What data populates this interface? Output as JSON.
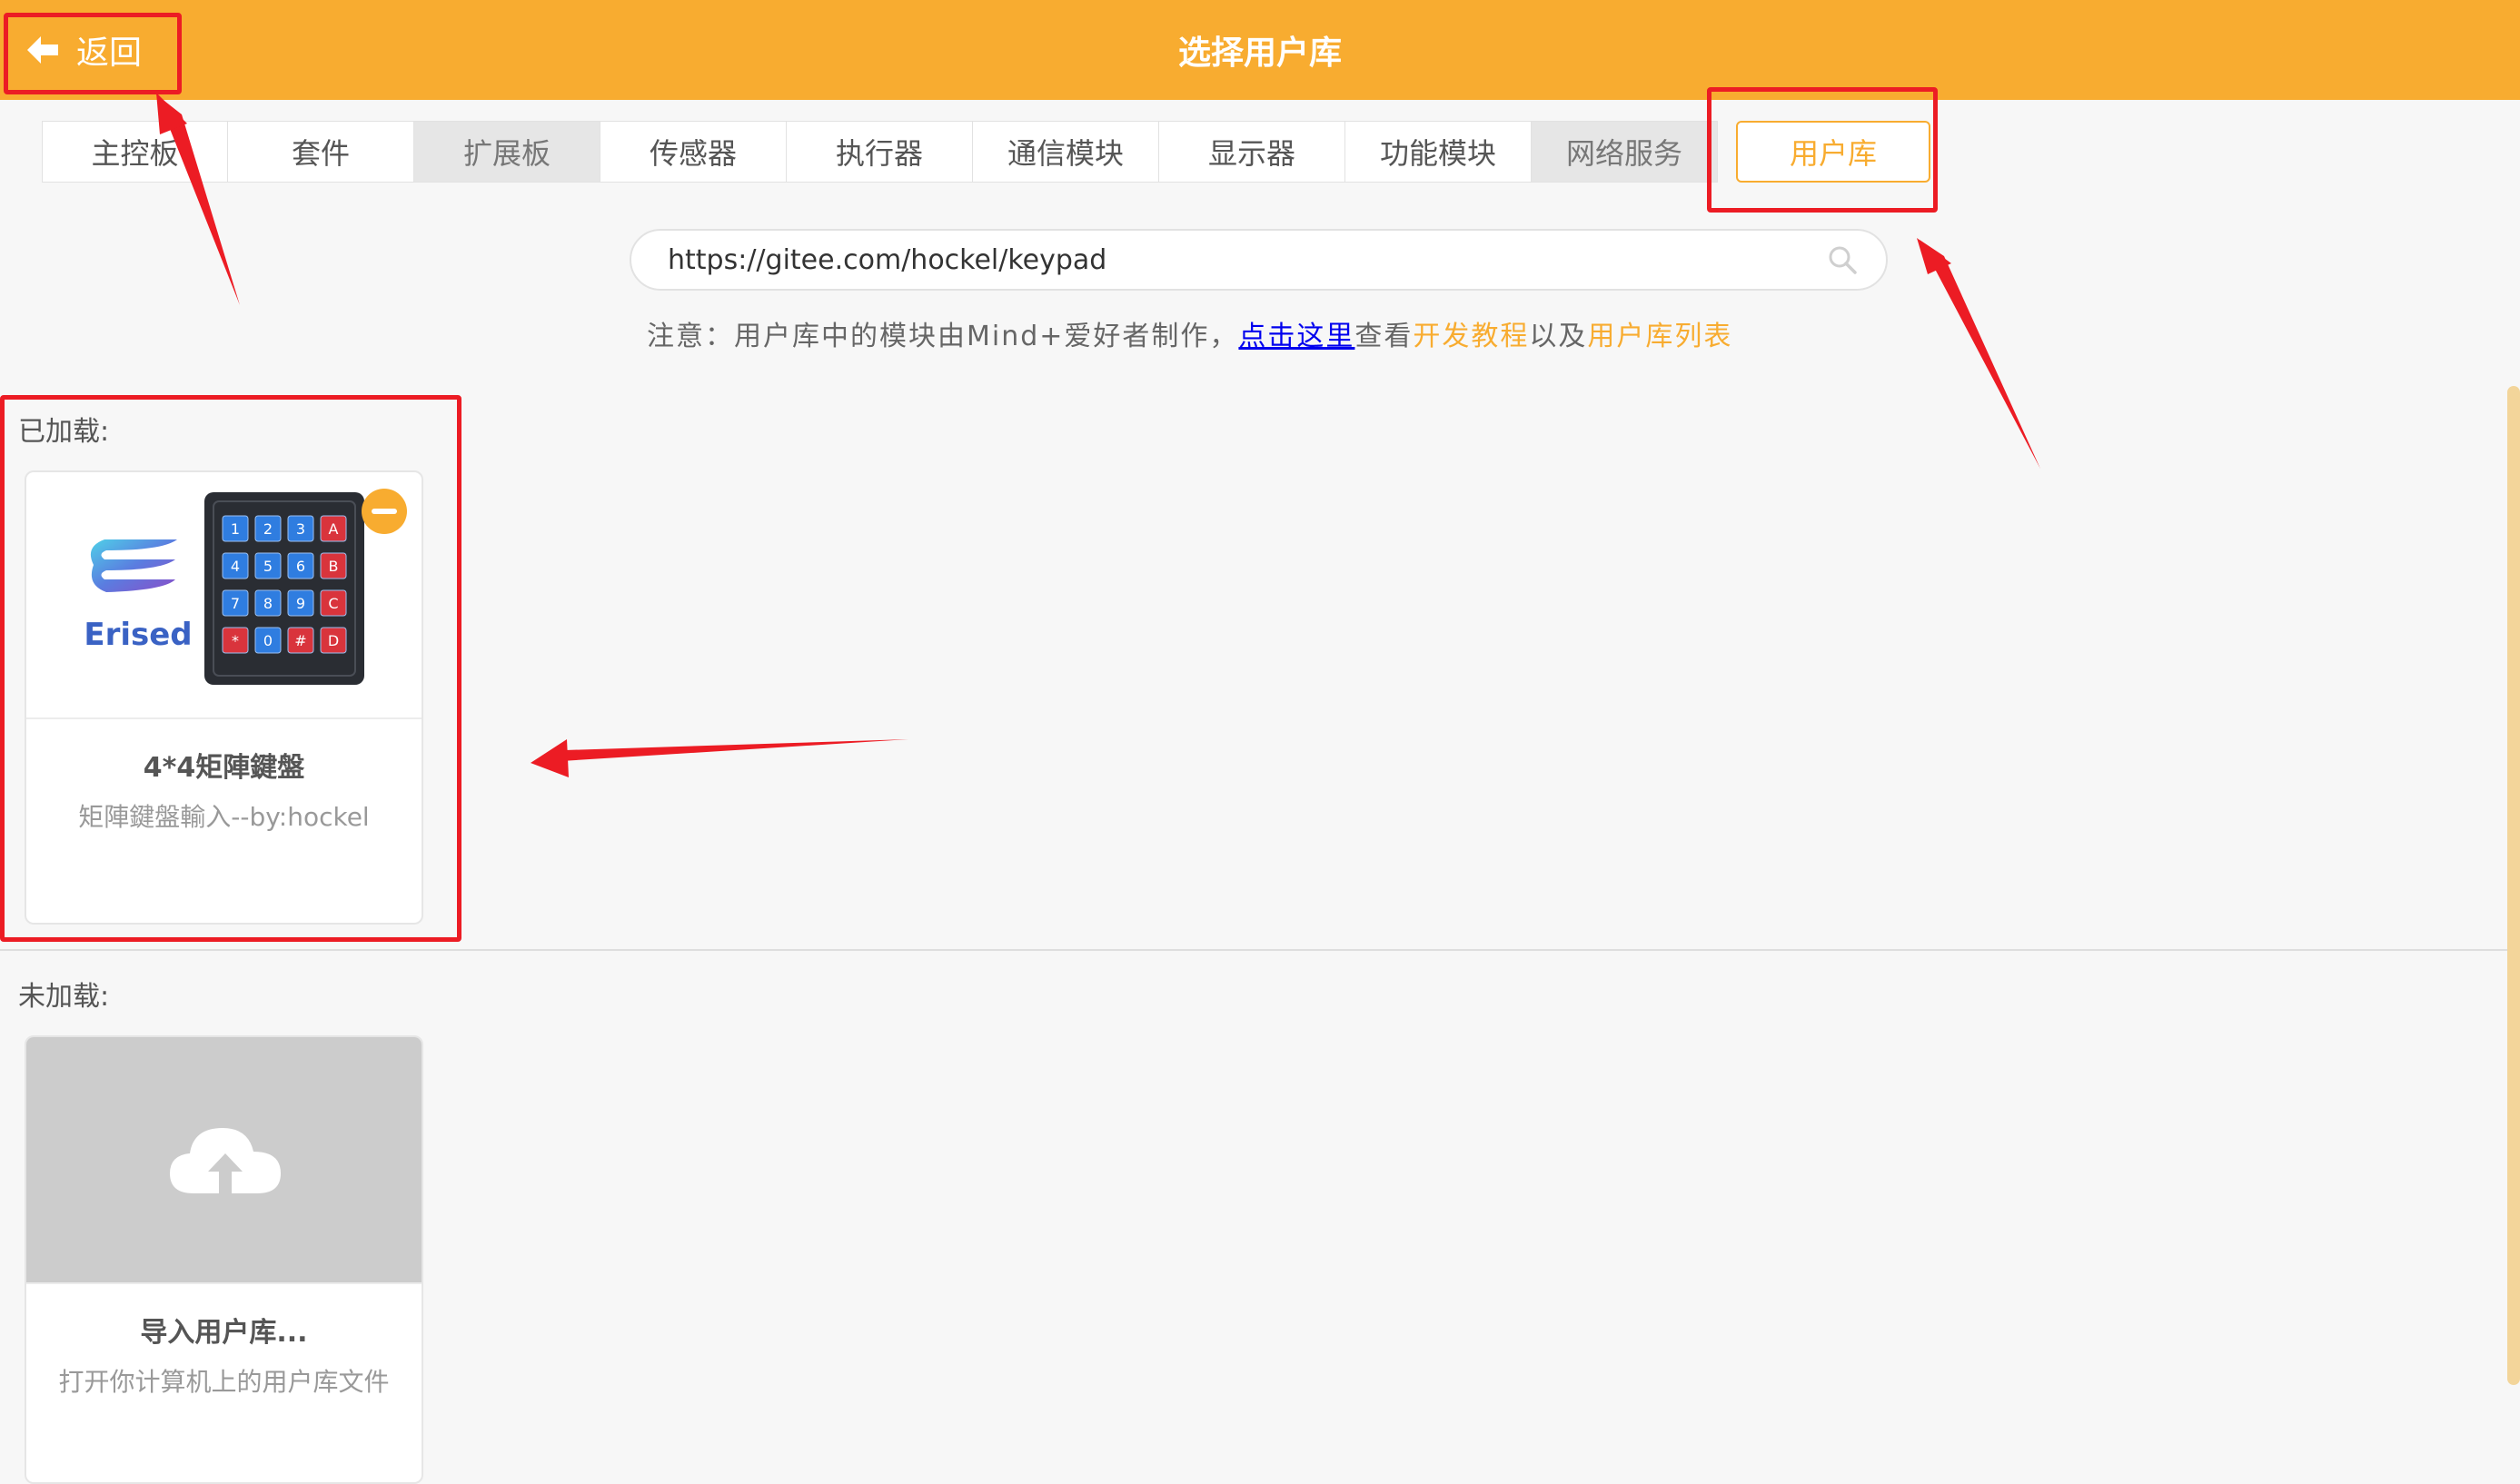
{
  "header": {
    "back_label": "返回",
    "title": "选择用户库",
    "background_color": "#f8ac30"
  },
  "tabs": [
    {
      "label": "主控板",
      "state": "normal"
    },
    {
      "label": "套件",
      "state": "normal"
    },
    {
      "label": "扩展板",
      "state": "disabled"
    },
    {
      "label": "传感器",
      "state": "normal"
    },
    {
      "label": "执行器",
      "state": "normal"
    },
    {
      "label": "通信模块",
      "state": "normal"
    },
    {
      "label": "显示器",
      "state": "normal"
    },
    {
      "label": "功能模块",
      "state": "normal"
    },
    {
      "label": "网络服务",
      "state": "disabled"
    },
    {
      "label": "用户库",
      "state": "active"
    }
  ],
  "search": {
    "value": "https://gitee.com/hockel/keypad",
    "icon": "search-icon"
  },
  "note": {
    "prefix": "注意：用户库中的模块由Mind+爱好者制作，",
    "link_here": "点击这里",
    "view": "查看",
    "dev_tutorial": "开发教程",
    "and": "以及",
    "lib_list": "用户库列表"
  },
  "loaded": {
    "label": "已加载:",
    "cards": [
      {
        "title": "4*4矩陣鍵盤",
        "description": "矩陣鍵盤輸入--by:hockel",
        "logo_text": "Erised",
        "keypad_keys": [
          "1",
          "2",
          "3",
          "A",
          "4",
          "5",
          "6",
          "B",
          "7",
          "8",
          "9",
          "C",
          "*",
          "0",
          "#",
          "D"
        ]
      }
    ]
  },
  "unloaded": {
    "label": "未加载:",
    "import_card": {
      "title": "导入用户库...",
      "description": "打开你计算机上的用户库文件",
      "icon": "cloud-upload-icon"
    }
  },
  "colors": {
    "accent": "#f8ac30",
    "annotation_red": "#ec1c24",
    "link_blue": "#0000ee"
  }
}
